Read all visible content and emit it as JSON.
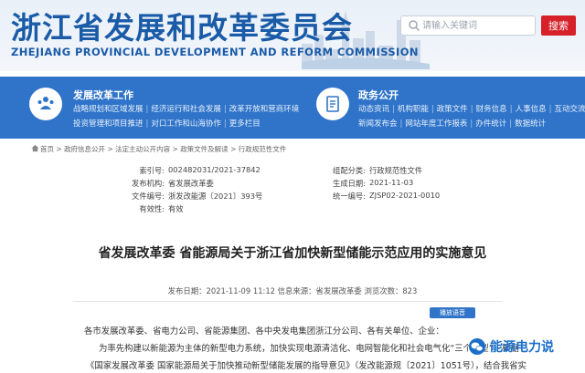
{
  "header": {
    "title_cn": "浙江省发展和改革委员会",
    "title_en": "ZHEJIANG PROVINCIAL DEVELOPMENT AND REFORM COMMISSION",
    "search_placeholder": "请输入关键词",
    "search_button": "搜索"
  },
  "nav": {
    "left": {
      "title": "发展改革工作",
      "line1": [
        "战略规划和区域发展",
        "经济运行和社会发展",
        "改革开放和营商环境"
      ],
      "line2": [
        "投资管理和项目推进",
        "对口工作和山海协作",
        "更多栏目"
      ]
    },
    "right": {
      "title": "政务公开",
      "line1": [
        "动态资讯",
        "机构职能",
        "政策文件",
        "财务信息",
        "人事信息",
        "互动交流"
      ],
      "line2": [
        "新闻发布会",
        "网站年度工作报表",
        "办件统计",
        "数据统计"
      ]
    }
  },
  "breadcrumb": [
    "首页",
    "政府信息公开",
    "法定主动公开内容",
    "政策文件及解读",
    "行政规范性文件"
  ],
  "meta": {
    "index_label": "索引号:",
    "index_value": "002482031/2021-37842",
    "agency_label": "发布机构:",
    "agency_value": "省发展改革委",
    "docno_label": "文件编号:",
    "docno_value": "浙发改能源〔2021〕393号",
    "valid_label": "有效性:",
    "valid_value": "有效",
    "cat_label": "组配分类:",
    "cat_value": "行政规范性文件",
    "date_label": "生成日期:",
    "date_value": "2021-11-03",
    "uni_label": "统一编号:",
    "uni_value": "ZJSP02-2021-0010"
  },
  "doc": {
    "title": "省发展改革委 省能源局关于浙江省加快新型储能示范应用的实施意见",
    "pubinfo": "发布日期：2021-11-09 11:12   信息来源：省发展改革委   浏览次数：823",
    "play_button": "播放语音",
    "p1": "各市发展改革委、省电力公司、省能源集团、各中央发电集团浙江分公司、各有关单位、企业：",
    "p2": "为率先构建以新能源为主体的新型电力系统，加快实现电源清洁化、电网智能化和社会电气化“三个转型”，根据",
    "p3": "《国家发展改革委 国家能源局关于加快推动新型储能发展的指导意见》（发改能源规〔2021〕1051号），结合我省实"
  },
  "watermark": {
    "text": "能源电力说"
  },
  "colors": {
    "brand_blue": "#1a5ba8",
    "nav_blue": "#2f74c9",
    "search_red": "#d6202a"
  }
}
